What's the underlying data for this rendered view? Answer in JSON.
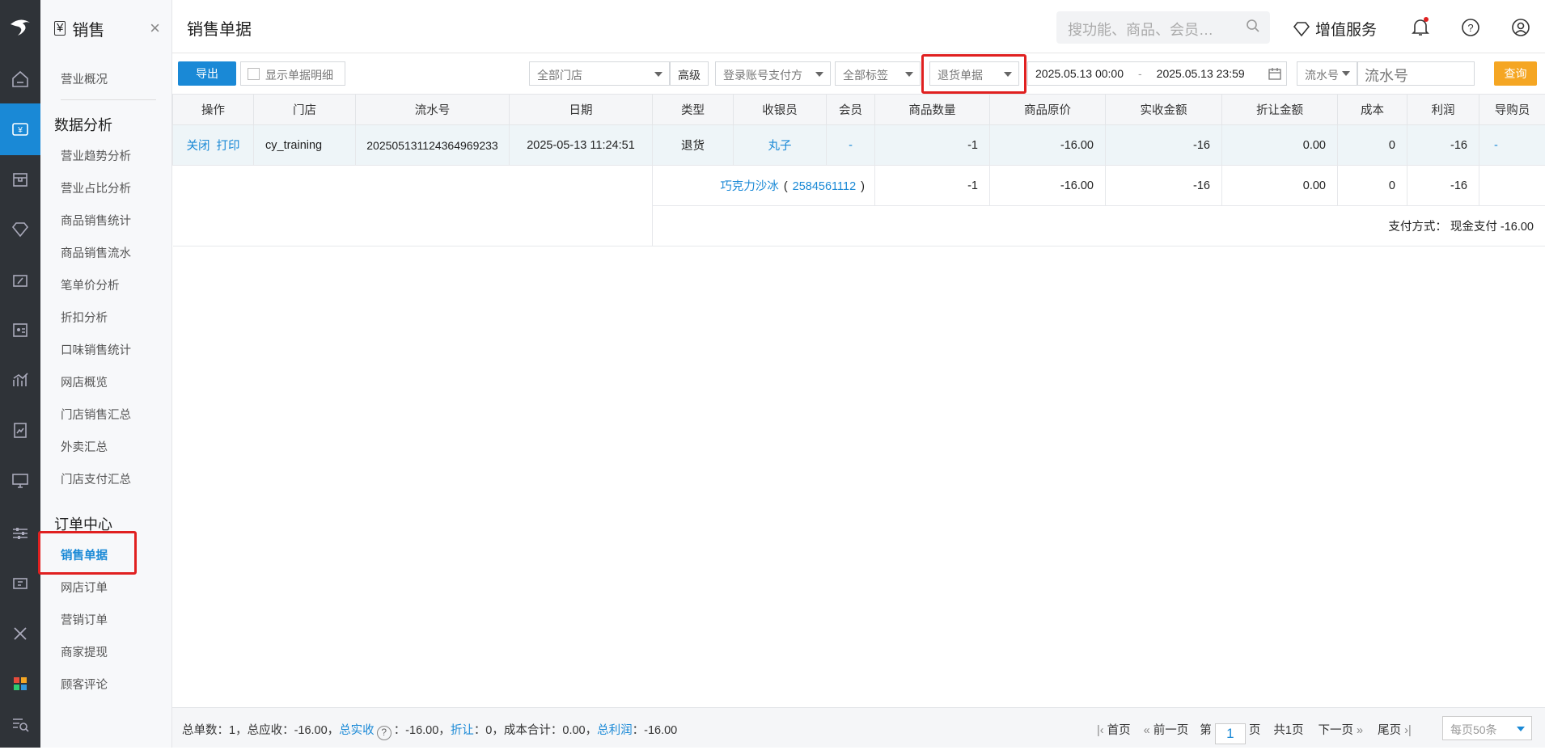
{
  "sidebar": {
    "title": "销售",
    "items": [
      "营业概况"
    ],
    "group1": "数据分析",
    "analysis": [
      "营业趋势分析",
      "营业占比分析",
      "商品销售统计",
      "商品销售流水",
      "笔单价分析",
      "折扣分析",
      "口味销售统计",
      "网店概览",
      "门店销售汇总",
      "外卖汇总",
      "门店支付汇总"
    ],
    "group2": "订单中心",
    "orders": [
      "销售单据",
      "网店订单",
      "营销订单",
      "商家提现",
      "顾客评论"
    ]
  },
  "header": {
    "title": "销售单据",
    "search_placeholder": "搜功能、商品、会员…",
    "vip": "增值服务"
  },
  "toolbar": {
    "export": "导出",
    "show_detail": "显示单据明细",
    "store": "全部门店",
    "advanced": "高级",
    "pay": "登录账号支付方",
    "tags": "全部标签",
    "doctype": "退货单据",
    "start": "2025.05.13 00:00",
    "dash": "-",
    "end": "2025.05.13 23:59",
    "serial_label": "流水号",
    "serial_placeholder": "流水号",
    "query": "查询"
  },
  "table": {
    "headers": [
      "操作",
      "门店",
      "流水号",
      "日期",
      "类型",
      "收银员",
      "会员",
      "商品数量",
      "商品原价",
      "实收金额",
      "折让金额",
      "成本",
      "利润",
      "导购员"
    ],
    "row": {
      "close": "关闭",
      "print": "打印",
      "store": "cy_training",
      "serial": "20250513112436496923​3",
      "date": "2025-05-13 11:24:51",
      "type": "退货",
      "cashier": "丸子",
      "member": "-",
      "qty": "-1",
      "price": "-16.00",
      "paid": "-16",
      "discount": "0.00",
      "cost": "0",
      "profit": "-16",
      "guide": "-"
    },
    "item": {
      "name": "巧克力沙冰",
      "open": "(",
      "code": "2584561112",
      "close": ")",
      "qty": "-1",
      "price": "-16.00",
      "paid": "-16",
      "discount": "0.00",
      "cost": "0",
      "profit": "-16"
    },
    "pay": "支付方式：  现金支付 -16.00"
  },
  "footer": {
    "a": "总单数：1，总应收：-16.00，",
    "b": "总实收",
    "c": "：-16.00，",
    "d": "折让",
    "e": "：0，成本合计：0.00，",
    "f": "总利润",
    "g": "：-16.00",
    "first": "首页",
    "prev": "前一页",
    "page_pre": "第",
    "page": "1",
    "page_post": "页",
    "total": "共1页",
    "next": "下一页",
    "last": "尾页",
    "per": "每页50条"
  }
}
